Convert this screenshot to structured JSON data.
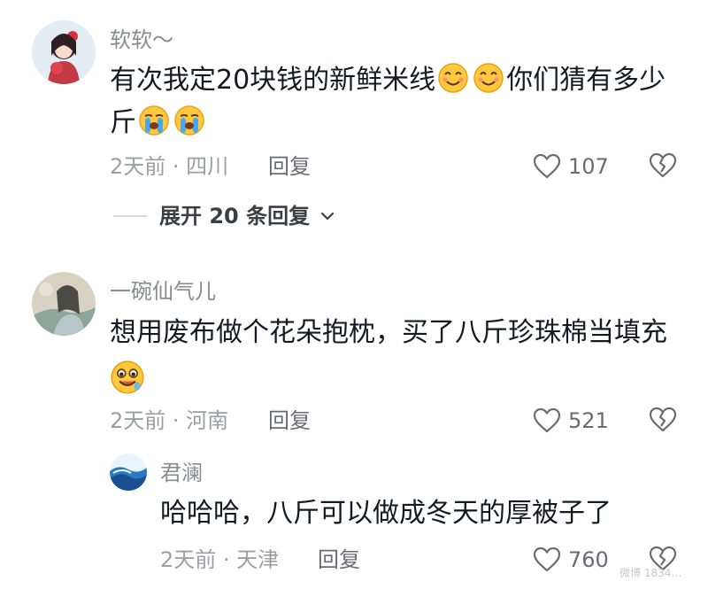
{
  "comments": [
    {
      "username": "软软～",
      "line1_a": "有次我定20块钱的新鲜米线",
      "line1_b": "你们猜有多少",
      "line2_a": "斤",
      "time_location": "2天前 · 四川",
      "reply_label": "回复",
      "likes": "107",
      "expand_label": "展开 20 条回复"
    },
    {
      "username": "一碗仙气儿",
      "line1": "想用废布做个花朵抱枕，买了八斤珍珠棉当填充",
      "time_location": "2天前 · 河南",
      "reply_label": "回复",
      "likes": "521"
    },
    {
      "username": "君澜",
      "line1": "哈哈哈，八斤可以做成冬天的厚被子了",
      "time_location": "2天前 · 天津",
      "reply_label": "回复",
      "likes": "760"
    }
  ],
  "watermark": "微博 1834…",
  "icons": {
    "like": "heart-outline-icon",
    "dislike": "broken-heart-icon",
    "expand": "chevron-down-icon",
    "emoji_smile": "smiling-face-icon",
    "emoji_cry": "crying-face-icon",
    "emoji_drool": "drooling-face-icon"
  }
}
